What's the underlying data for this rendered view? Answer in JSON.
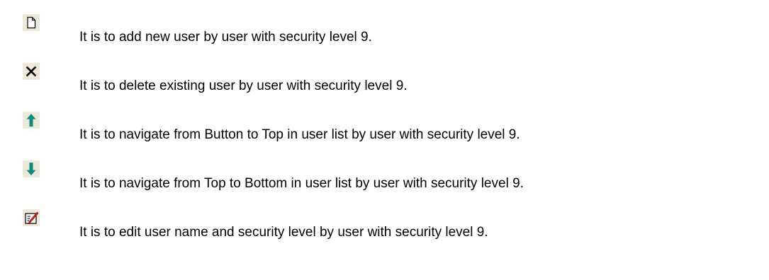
{
  "legend": {
    "rows": [
      {
        "icon": "new-document-icon",
        "text": "It is to add new user by user with security level 9."
      },
      {
        "icon": "delete-x-icon",
        "text": "It is to delete existing user by user with security level 9."
      },
      {
        "icon": "arrow-up-icon",
        "text": "It is to navigate from Button to Top in user list by user with security level 9."
      },
      {
        "icon": "arrow-down-icon",
        "text": "It is to navigate from Top to Bottom in user list by user with security level 9."
      },
      {
        "icon": "edit-pen-icon",
        "text": "It is to edit user name and security level by user with security level 9."
      }
    ]
  },
  "colors": {
    "icon_background": "#ece9d8",
    "arrow_teal": "#0f8a80",
    "pen_red": "#e02020",
    "text": "#000000"
  }
}
